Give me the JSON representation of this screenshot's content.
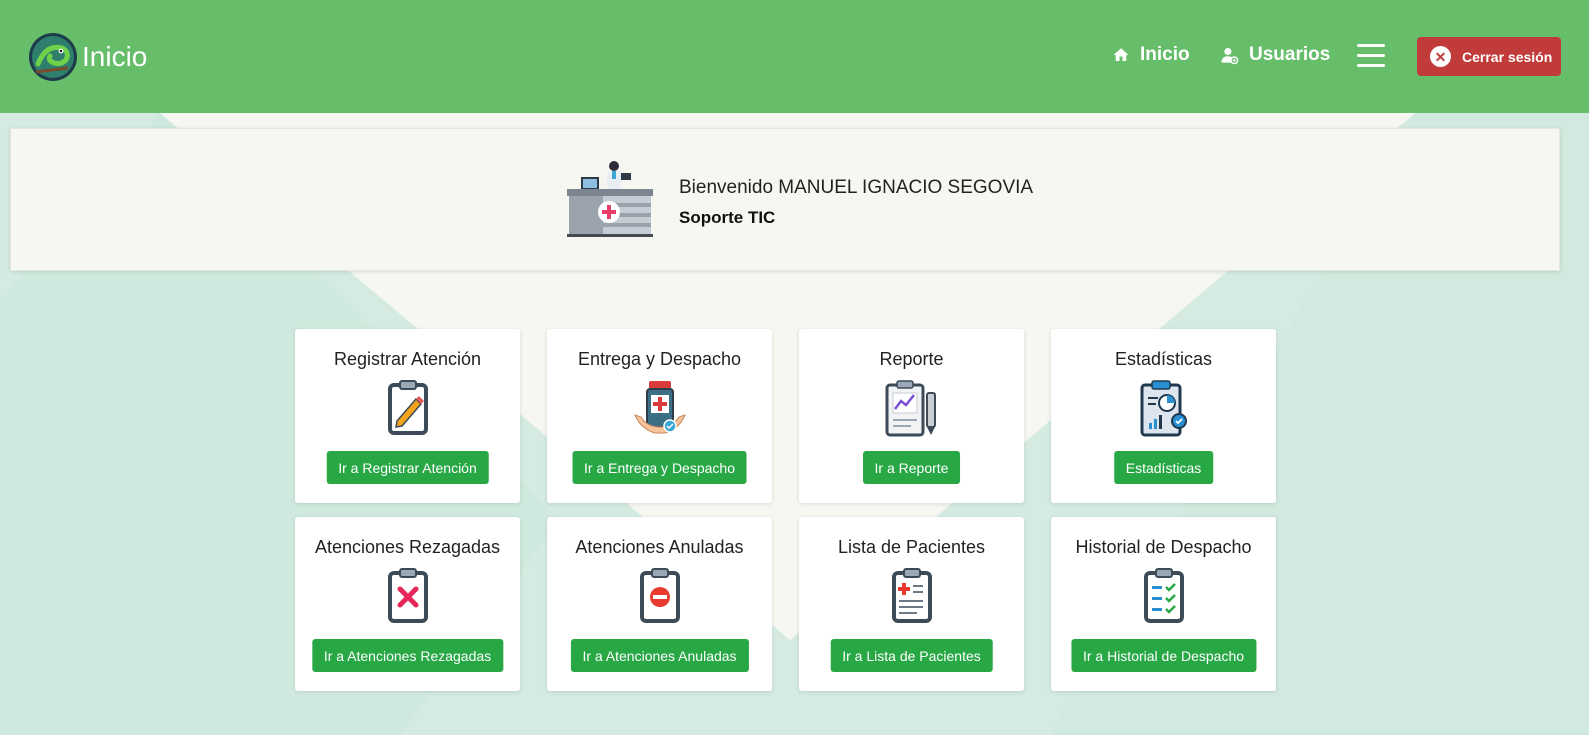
{
  "navbar": {
    "brand_title": "Inicio",
    "links": [
      {
        "label": "Inicio",
        "icon": "home-icon"
      },
      {
        "label": "Usuarios",
        "icon": "users-icon"
      }
    ],
    "logout_label": "Cerrar sesión",
    "colors": {
      "navbar": "#66bd6a",
      "logout": "#c23b3b"
    }
  },
  "welcome": {
    "greeting": "Bienvenido MANUEL IGNACIO SEGOVIA",
    "role": "Soporte TIC"
  },
  "cards": [
    {
      "title": "Registrar Atención",
      "button": "Ir a Registrar Atención",
      "icon": "clipboard-pencil-icon"
    },
    {
      "title": "Entrega y Despacho",
      "button": "Ir a Entrega y Despacho",
      "icon": "medicine-hand-icon"
    },
    {
      "title": "Reporte",
      "button": "Ir a Reporte",
      "icon": "report-chart-icon"
    },
    {
      "title": "Estadísticas",
      "button": "Estadísticas",
      "icon": "statistics-clipboard-icon"
    },
    {
      "title": "Atenciones Rezagadas",
      "button": "Ir a Atenciones Rezagadas",
      "icon": "clipboard-x-icon"
    },
    {
      "title": "Atenciones Anuladas",
      "button": "Ir a Atenciones Anuladas",
      "icon": "clipboard-minus-icon"
    },
    {
      "title": "Lista de Pacientes",
      "button": "Ir a Lista de Pacientes",
      "icon": "clipboard-medical-icon"
    },
    {
      "title": "Historial de Despacho",
      "button": "Ir a Historial de Despacho",
      "icon": "clipboard-checklist-icon"
    }
  ],
  "colors": {
    "button": "#28a745",
    "background": "#d8ece4"
  }
}
